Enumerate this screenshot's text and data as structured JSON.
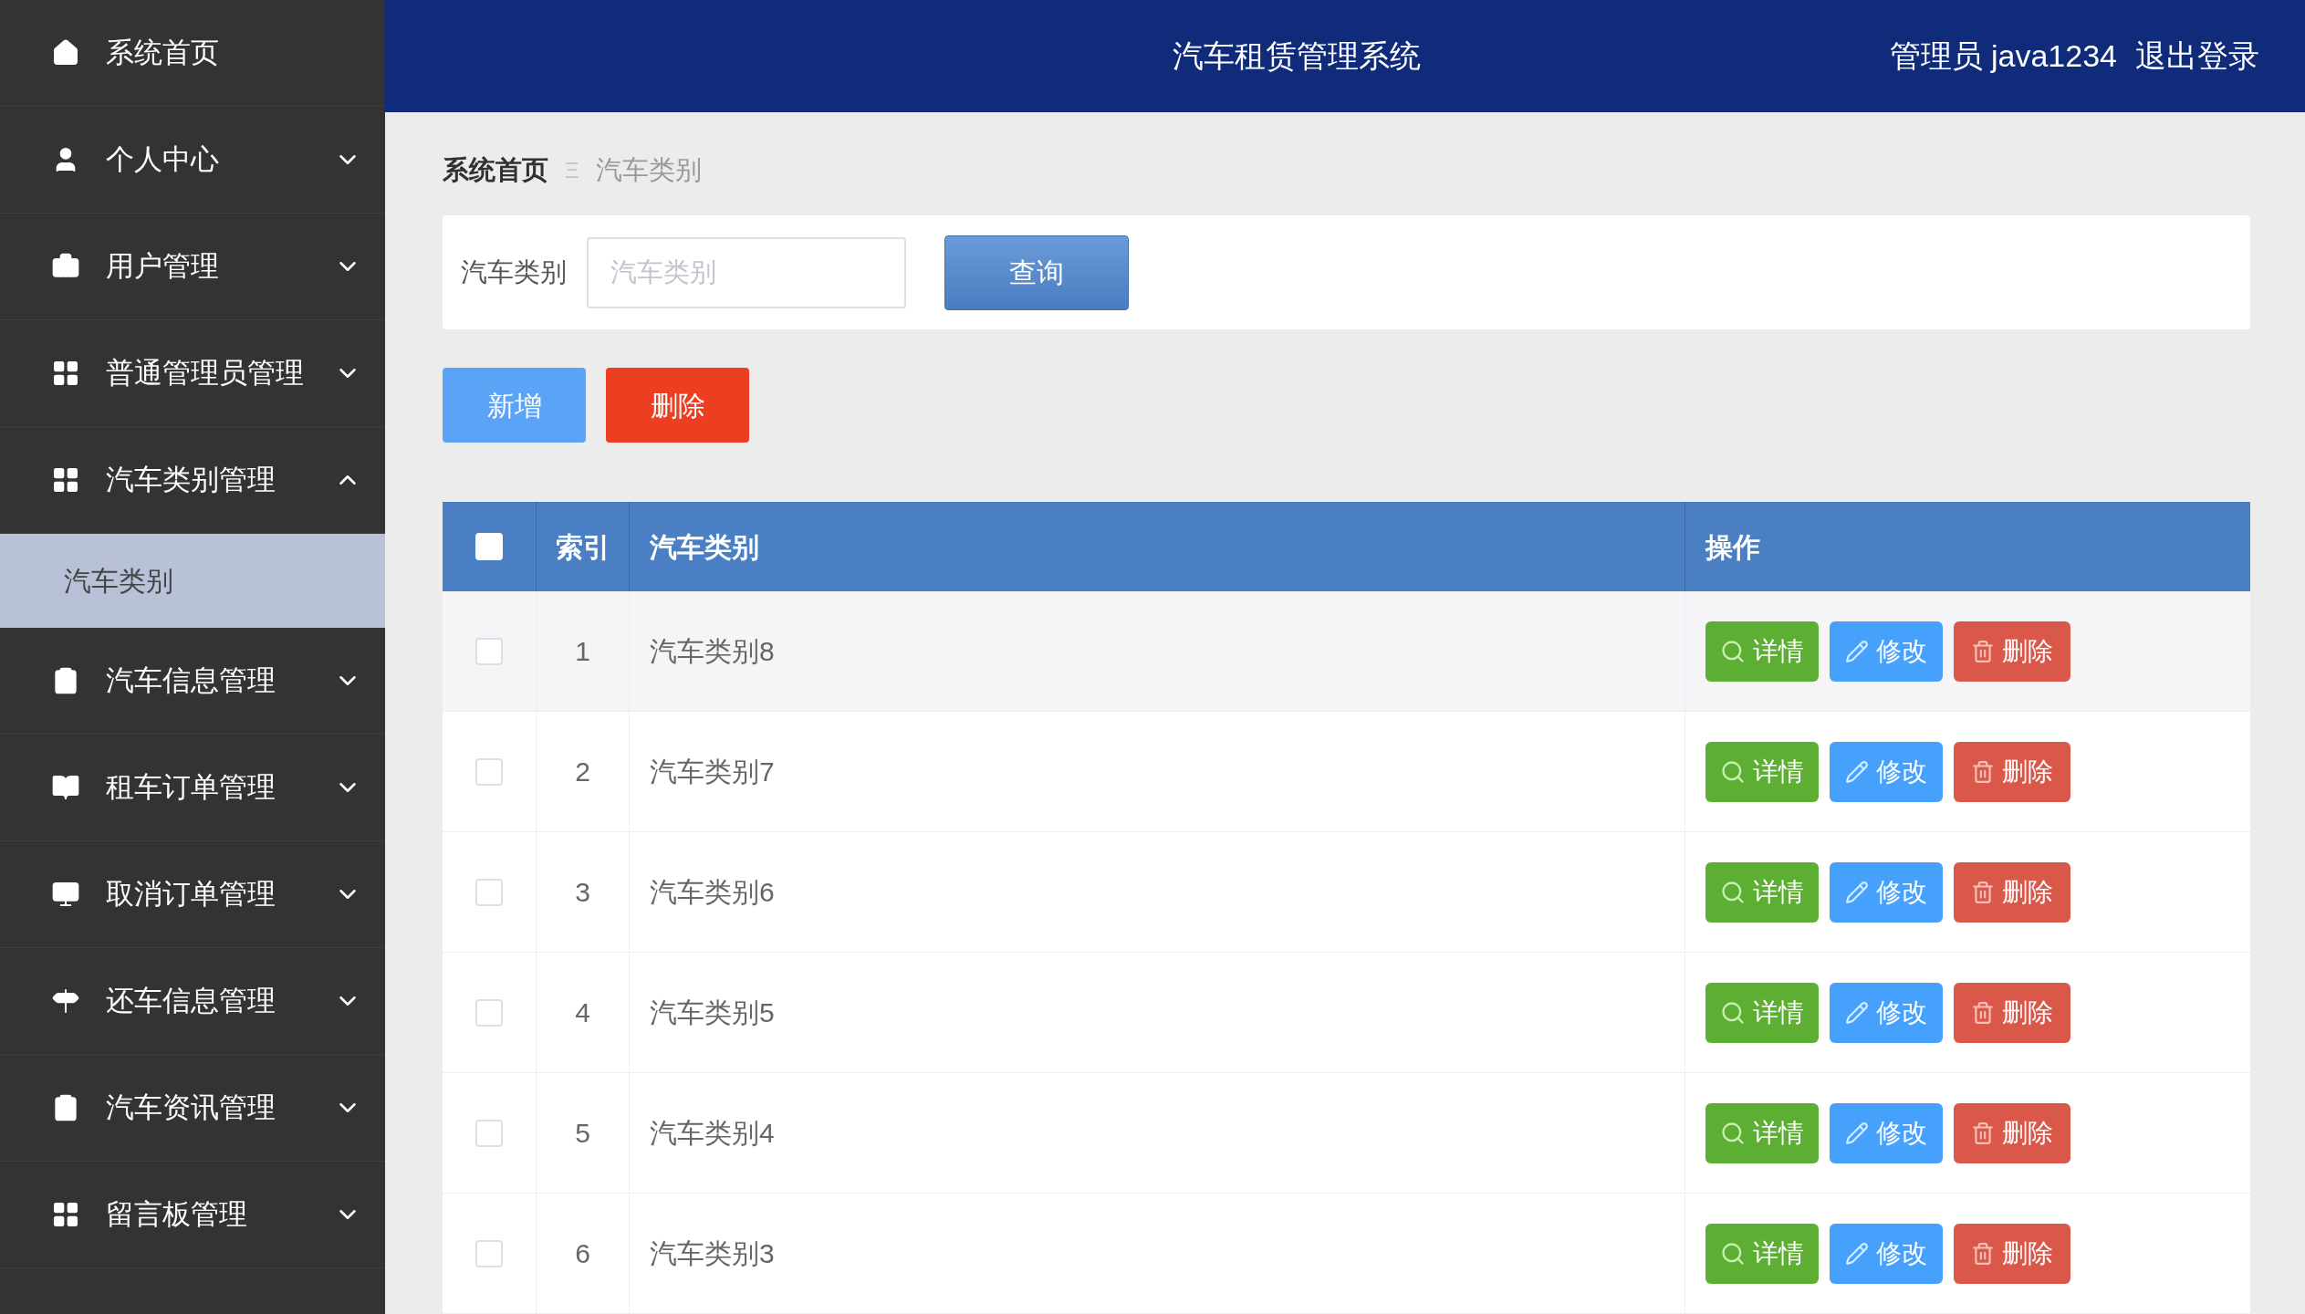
{
  "sidebar": {
    "items": [
      {
        "kind": "link",
        "label": "系统首页"
      },
      {
        "kind": "menu",
        "label": "个人中心",
        "expanded": false
      },
      {
        "kind": "menu",
        "label": "用户管理",
        "expanded": false
      },
      {
        "kind": "menu",
        "label": "普通管理员管理",
        "expanded": false
      },
      {
        "kind": "menu",
        "label": "汽车类别管理",
        "expanded": true,
        "children": [
          {
            "label": "汽车类别",
            "selected": true
          }
        ]
      },
      {
        "kind": "menu",
        "label": "汽车信息管理",
        "expanded": false
      },
      {
        "kind": "menu",
        "label": "租车订单管理",
        "expanded": false
      },
      {
        "kind": "menu",
        "label": "取消订单管理",
        "expanded": false
      },
      {
        "kind": "menu",
        "label": "还车信息管理",
        "expanded": false
      },
      {
        "kind": "menu",
        "label": "汽车资讯管理",
        "expanded": false
      },
      {
        "kind": "menu",
        "label": "留言板管理",
        "expanded": false
      }
    ]
  },
  "header": {
    "title": "汽车租赁管理系统",
    "user": "管理员 java1234",
    "logout": "退出登录"
  },
  "breadcrumb": {
    "items": [
      "系统首页",
      "汽车类别"
    ],
    "separator": "Ξ"
  },
  "search": {
    "label": "汽车类别",
    "placeholder": "汽车类别",
    "button": "查询"
  },
  "actions": {
    "add": "新增",
    "delete": "删除"
  },
  "table": {
    "header_checked": false,
    "columns": [
      "索引",
      "汽车类别",
      "操作"
    ],
    "rows": [
      {
        "checked": false,
        "index": "1",
        "category": "汽车类别8",
        "actions": {
          "detail": "详情",
          "edit": "修改",
          "delete": "删除"
        }
      },
      {
        "checked": false,
        "index": "2",
        "category": "汽车类别7",
        "actions": {
          "detail": "详情",
          "edit": "修改",
          "delete": "删除"
        }
      },
      {
        "checked": false,
        "index": "3",
        "category": "汽车类别6",
        "actions": {
          "detail": "详情",
          "edit": "修改",
          "delete": "删除"
        }
      },
      {
        "checked": false,
        "index": "4",
        "category": "汽车类别5",
        "actions": {
          "detail": "详情",
          "edit": "修改",
          "delete": "删除"
        }
      },
      {
        "checked": false,
        "index": "5",
        "category": "汽车类别4",
        "actions": {
          "detail": "详情",
          "edit": "修改",
          "delete": "删除"
        }
      },
      {
        "checked": false,
        "index": "6",
        "category": "汽车类别3",
        "actions": {
          "detail": "详情",
          "edit": "修改",
          "delete": "删除"
        }
      }
    ]
  }
}
